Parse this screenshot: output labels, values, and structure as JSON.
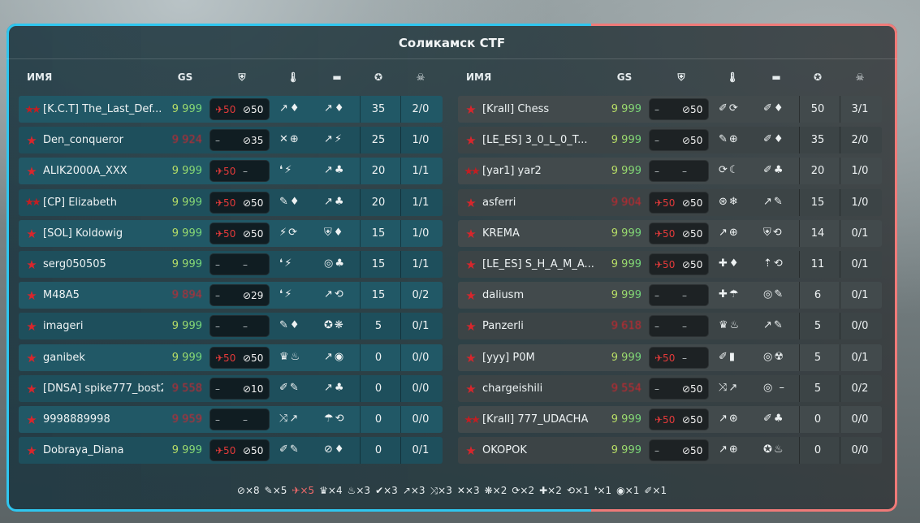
{
  "title": "Соликамск CTF",
  "headers": {
    "name": "ИМЯ",
    "gs": "GS",
    "armor_icon": "shield-icon",
    "turret_icon": "thermometer-icon",
    "hull_icon": "tank-icon",
    "score_icon": "star-badge-icon",
    "kd_icon": "skull-icon"
  },
  "colors": {
    "blue_team": "#2fc6ef",
    "red_team": "#f07a78",
    "gs_normal": "#d5e34a",
    "gs_hidden": "#e0232b"
  },
  "teams": [
    {
      "side": "blue",
      "players": [
        {
          "name": "[K.C.T] The_Last_Def...",
          "gs": "9 999",
          "gs_hidden": false,
          "s1": "50",
          "s2": "50",
          "score": "35",
          "kd": "2/0",
          "rank": "legend",
          "turret": "↗♦",
          "hull": "↗♦"
        },
        {
          "name": "Den_conqueror",
          "gs": "9 924",
          "gs_hidden": true,
          "s1": "–",
          "s2": "35",
          "score": "25",
          "kd": "1/0",
          "rank": "star",
          "turret": "✕⊕",
          "hull": "↗⚡"
        },
        {
          "name": "ALIK2000A_XXX",
          "gs": "9 999",
          "gs_hidden": false,
          "s1": "50",
          "s2": "–",
          "score": "20",
          "kd": "1/1",
          "rank": "star",
          "turret": "❛⚡",
          "hull": "↗♣"
        },
        {
          "name": "[CP] Elizabeth",
          "gs": "9 999",
          "gs_hidden": false,
          "s1": "50",
          "s2": "50",
          "score": "20",
          "kd": "1/1",
          "rank": "legend",
          "turret": "✎♦",
          "hull": "↗♣"
        },
        {
          "name": "[SOL] Koldowig",
          "gs": "9 999",
          "gs_hidden": false,
          "s1": "50",
          "s2": "50",
          "score": "15",
          "kd": "1/0",
          "rank": "star",
          "turret": "⚡⟳",
          "hull": "⛨♦"
        },
        {
          "name": "serg050505",
          "gs": "9 999",
          "gs_hidden": false,
          "s1": "–",
          "s2": "–",
          "score": "15",
          "kd": "1/1",
          "rank": "star",
          "turret": "❛⚡",
          "hull": "◎♣"
        },
        {
          "name": "M48A5",
          "gs": "9 894",
          "gs_hidden": true,
          "s1": "–",
          "s2": "29",
          "score": "15",
          "kd": "0/2",
          "rank": "star",
          "turret": "❛⚡",
          "hull": "↗⟲"
        },
        {
          "name": "imageri",
          "gs": "9 999",
          "gs_hidden": false,
          "s1": "–",
          "s2": "–",
          "score": "5",
          "kd": "0/1",
          "rank": "star",
          "turret": "✎♦",
          "hull": "✪❋"
        },
        {
          "name": "ganibek",
          "gs": "9 999",
          "gs_hidden": false,
          "s1": "50",
          "s2": "50",
          "score": "0",
          "kd": "0/0",
          "rank": "star",
          "turret": "♛♨",
          "hull": "↗◉"
        },
        {
          "name": "[DNSA] spike777_bost2",
          "gs": "9 558",
          "gs_hidden": true,
          "s1": "–",
          "s2": "10",
          "score": "0",
          "kd": "0/0",
          "rank": "star",
          "turret": "✐✎",
          "hull": "↗♣"
        },
        {
          "name": "9998889998",
          "gs": "9 959",
          "gs_hidden": true,
          "s1": "–",
          "s2": "–",
          "score": "0",
          "kd": "0/0",
          "rank": "star",
          "turret": "⤨↗",
          "hull": "☂⟲"
        },
        {
          "name": "Dobraya_Diana",
          "gs": "9 999",
          "gs_hidden": false,
          "s1": "50",
          "s2": "50",
          "score": "0",
          "kd": "0/1",
          "rank": "star",
          "turret": "✐✎",
          "hull": "⊘♦"
        }
      ]
    },
    {
      "side": "red",
      "players": [
        {
          "name": "[Krall] Chess",
          "gs": "9 999",
          "gs_hidden": false,
          "s1": "–",
          "s2": "50",
          "score": "50",
          "kd": "3/1",
          "rank": "star",
          "turret": "✐⟳",
          "hull": "✐♦"
        },
        {
          "name": "[LE_ES] 3_0_L_0_T...",
          "gs": "9 999",
          "gs_hidden": false,
          "s1": "–",
          "s2": "50",
          "score": "35",
          "kd": "2/0",
          "rank": "star",
          "turret": "✎⊕",
          "hull": "✐♦"
        },
        {
          "name": "[yar1] yar2",
          "gs": "9 999",
          "gs_hidden": false,
          "s1": "–",
          "s2": "–",
          "score": "20",
          "kd": "1/0",
          "rank": "legend",
          "turret": "⟳☾",
          "hull": "✐♣"
        },
        {
          "name": "asferri",
          "gs": "9 904",
          "gs_hidden": true,
          "s1": "50",
          "s2": "50",
          "score": "15",
          "kd": "1/0",
          "rank": "star",
          "turret": "⊛❄",
          "hull": "↗✎"
        },
        {
          "name": "KREMA",
          "gs": "9 999",
          "gs_hidden": false,
          "s1": "50",
          "s2": "50",
          "score": "14",
          "kd": "0/1",
          "rank": "star",
          "turret": "↗⊕",
          "hull": "⛨⟲"
        },
        {
          "name": "[LE_ES] S_H_A_M_A...",
          "gs": "9 999",
          "gs_hidden": false,
          "s1": "50",
          "s2": "50",
          "score": "11",
          "kd": "0/1",
          "rank": "star",
          "turret": "✚♦",
          "hull": "⇡⟲"
        },
        {
          "name": "daliusm",
          "gs": "9 999",
          "gs_hidden": false,
          "s1": "–",
          "s2": "–",
          "score": "6",
          "kd": "0/1",
          "rank": "star",
          "turret": "✚☂",
          "hull": "◎✎"
        },
        {
          "name": "Panzerli",
          "gs": "9 618",
          "gs_hidden": true,
          "s1": "–",
          "s2": "–",
          "score": "5",
          "kd": "0/0",
          "rank": "star",
          "turret": "♛♨",
          "hull": "↗✎"
        },
        {
          "name": "[yyy] P0M",
          "gs": "9 999",
          "gs_hidden": false,
          "s1": "50",
          "s2": "–",
          "score": "5",
          "kd": "0/1",
          "rank": "star",
          "turret": "✐▮",
          "hull": "◎☢"
        },
        {
          "name": "chargeishili",
          "gs": "9 554",
          "gs_hidden": true,
          "s1": "–",
          "s2": "50",
          "score": "5",
          "kd": "0/2",
          "rank": "star",
          "turret": "⤨↗",
          "hull": "◎ –"
        },
        {
          "name": "[Krall] 777_UDACHA",
          "gs": "9 999",
          "gs_hidden": false,
          "s1": "50",
          "s2": "50",
          "score": "0",
          "kd": "0/0",
          "rank": "legend",
          "turret": "↗⊛",
          "hull": "✐♣"
        },
        {
          "name": "OKOPOK",
          "gs": "9 999",
          "gs_hidden": false,
          "s1": "–",
          "s2": "50",
          "score": "0",
          "kd": "0/0",
          "rank": "star",
          "turret": "↗⊕",
          "hull": "✪♨"
        }
      ]
    }
  ],
  "footer": [
    {
      "icon": "⊘",
      "count": "×8"
    },
    {
      "icon": "✎",
      "count": "×5"
    },
    {
      "icon": "✈",
      "count": "×5",
      "highlight": true
    },
    {
      "icon": "♛",
      "count": "×4"
    },
    {
      "icon": "♨",
      "count": "×3"
    },
    {
      "icon": "✔",
      "count": "×3"
    },
    {
      "icon": "↗",
      "count": "×3"
    },
    {
      "icon": "⤨",
      "count": "×3"
    },
    {
      "icon": "✕",
      "count": "×3"
    },
    {
      "icon": "❋",
      "count": "×2"
    },
    {
      "icon": "⟳",
      "count": "×2"
    },
    {
      "icon": "✚",
      "count": "×2"
    },
    {
      "icon": "⟲",
      "count": "×1"
    },
    {
      "icon": "❛",
      "count": "×1"
    },
    {
      "icon": "◉",
      "count": "×1"
    },
    {
      "icon": "✐",
      "count": "×1"
    }
  ]
}
